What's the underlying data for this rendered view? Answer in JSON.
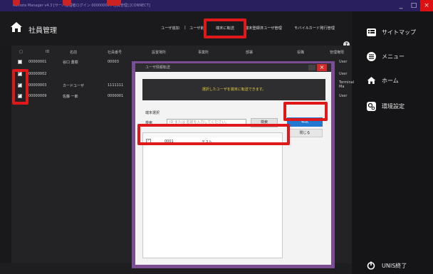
{
  "window": {
    "title": "Remote Manager v4.3 [サーバ管理者ログイン 00000000 / 社員管理] [CONNECT]",
    "minimize": "_",
    "maximize": "□",
    "close": "×"
  },
  "header": {
    "app_title": "社員管理",
    "nav": [
      "ユーザ追加",
      "ユーザ削",
      "端末に転送",
      "端末登録済ユーザ管理",
      "モバイルカード発行管理"
    ],
    "separator": "|",
    "help": "?"
  },
  "sidebar": {
    "items": [
      {
        "label": "サイトマップ",
        "icon": "sitemap-icon"
      },
      {
        "label": "メニュー",
        "icon": "menu-icon"
      },
      {
        "label": "ホーム",
        "icon": "home-icon"
      },
      {
        "label": "環境設定",
        "icon": "settings-icon"
      }
    ],
    "exit_label": "UNIS終了"
  },
  "table": {
    "columns": [
      "ID",
      "名前",
      "社員番号",
      "設置場所",
      "事業所",
      "部署",
      "役職",
      "管理権限"
    ],
    "rows": [
      {
        "checked": false,
        "id": "00000001",
        "name": "谷口 勇樹",
        "empno": "00003",
        "role": "User"
      },
      {
        "checked": true,
        "id": "00000002",
        "name": "",
        "empno": "",
        "role": "User"
      },
      {
        "checked": true,
        "id": "00000003",
        "name": "カードユーザ",
        "empno": "1111111",
        "role": "Terminal Ma"
      },
      {
        "checked": true,
        "id": "00000009",
        "name": "佐藤 一郎",
        "empno": "0000001",
        "role": "User"
      }
    ]
  },
  "modal": {
    "title": "ユーザ情報転送",
    "message": "選択したユーザを端末に転送できます。",
    "section_label": "端末選択",
    "search_label": "検索",
    "search_placeholder": "ID または 名前を入力してください。",
    "search_button": "検索",
    "transfer_button": "転送",
    "close_button": "閉じる",
    "close_x": "×",
    "terminals": [
      {
        "checked": true,
        "id": "0001",
        "name": "テスト"
      }
    ]
  },
  "colors": {
    "highlight": "#e0181a",
    "modal_border": "#7a4d94",
    "primary_button": "#2277d0",
    "banner_text": "#e6c93e"
  }
}
